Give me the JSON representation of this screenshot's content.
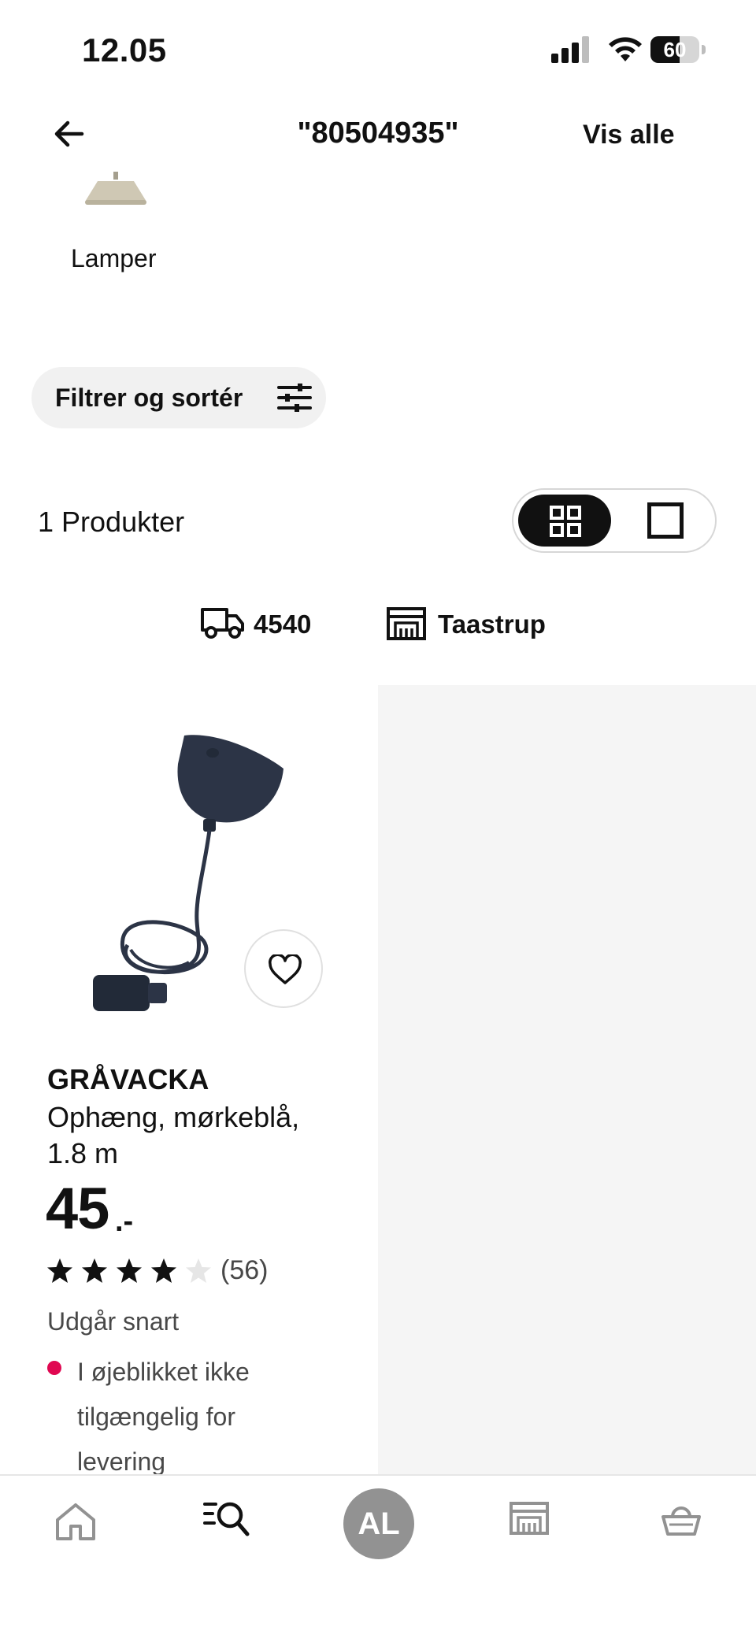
{
  "status_bar": {
    "time": "12.05",
    "battery": "60"
  },
  "header": {
    "title": "\"80504935\"",
    "show_all": "Vis alle"
  },
  "category": {
    "label": "Lamper"
  },
  "filter": {
    "label": "Filtrer og sortér"
  },
  "results": {
    "count_label": "1 Produkter",
    "view_mode": "grid"
  },
  "location": {
    "postal_code": "4540",
    "store": "Taastrup"
  },
  "product": {
    "name": "GRÅVACKA",
    "description": "Ophæng, mørkeblå, 1.8 m",
    "price": "45",
    "price_suffix": ".-",
    "rating": 4,
    "rating_max": 5,
    "reviews": "(56)",
    "status": "Udgår snart",
    "availability": "I øjeblikket ikke tilgængelig for levering",
    "availability_color": "#e00751"
  },
  "nav": {
    "avatar_initials": "AL",
    "items": [
      "home-icon",
      "search-icon",
      "avatar",
      "store-icon",
      "basket-icon"
    ]
  },
  "colors": {
    "accent_dark": "#111111",
    "panel_grey": "#f5f5f5",
    "avatar_grey": "#929292"
  }
}
